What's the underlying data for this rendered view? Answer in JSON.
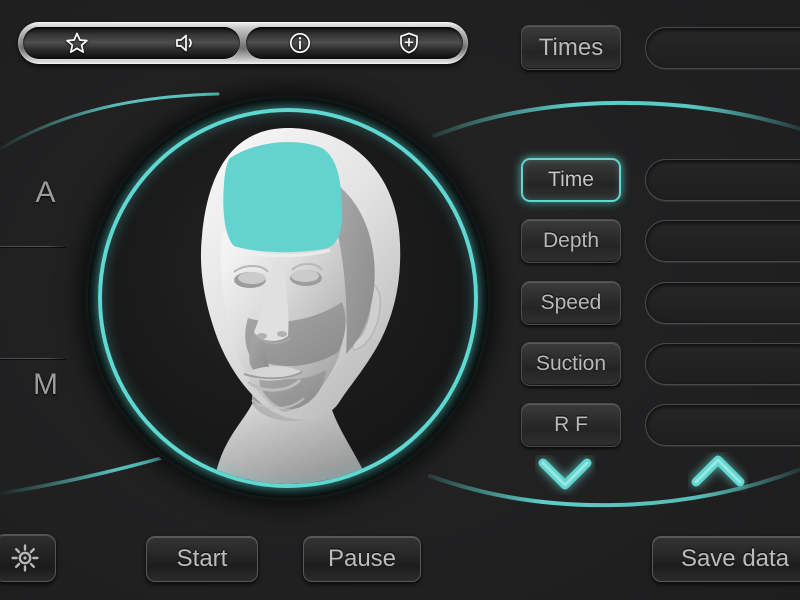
{
  "app": {
    "background_color": "#202021",
    "accent_color": "#62d6cf",
    "text_color": "#b9b9b9"
  },
  "toolbar": {
    "icons": [
      {
        "name": "star-icon",
        "label": "Favorite"
      },
      {
        "name": "volume-icon",
        "label": "Sound"
      },
      {
        "name": "info-icon",
        "label": "Information"
      },
      {
        "name": "shield-plus-icon",
        "label": "Protection"
      }
    ]
  },
  "left_rail": {
    "mode_auto": "A",
    "mode_manual": "M"
  },
  "viewer": {
    "region_label": "",
    "highlight_color": "#64d3d0",
    "ring_color": "#5fd8d2"
  },
  "times": {
    "label": "Times",
    "value": ""
  },
  "parameters": [
    {
      "label": "Time",
      "value": "",
      "selected": true
    },
    {
      "label": "Depth",
      "value": "",
      "selected": false
    },
    {
      "label": "Speed",
      "value": "",
      "selected": false
    },
    {
      "label": "Suction",
      "value": "",
      "selected": false
    },
    {
      "label": "R F",
      "value": "",
      "selected": false
    }
  ],
  "steppers": {
    "decrease": "chevron-down-icon",
    "increase": "chevron-up-icon"
  },
  "footer": {
    "settings_icon": "gear-icon",
    "start_label": "Start",
    "pause_label": "Pause",
    "save_label": "Save data"
  }
}
